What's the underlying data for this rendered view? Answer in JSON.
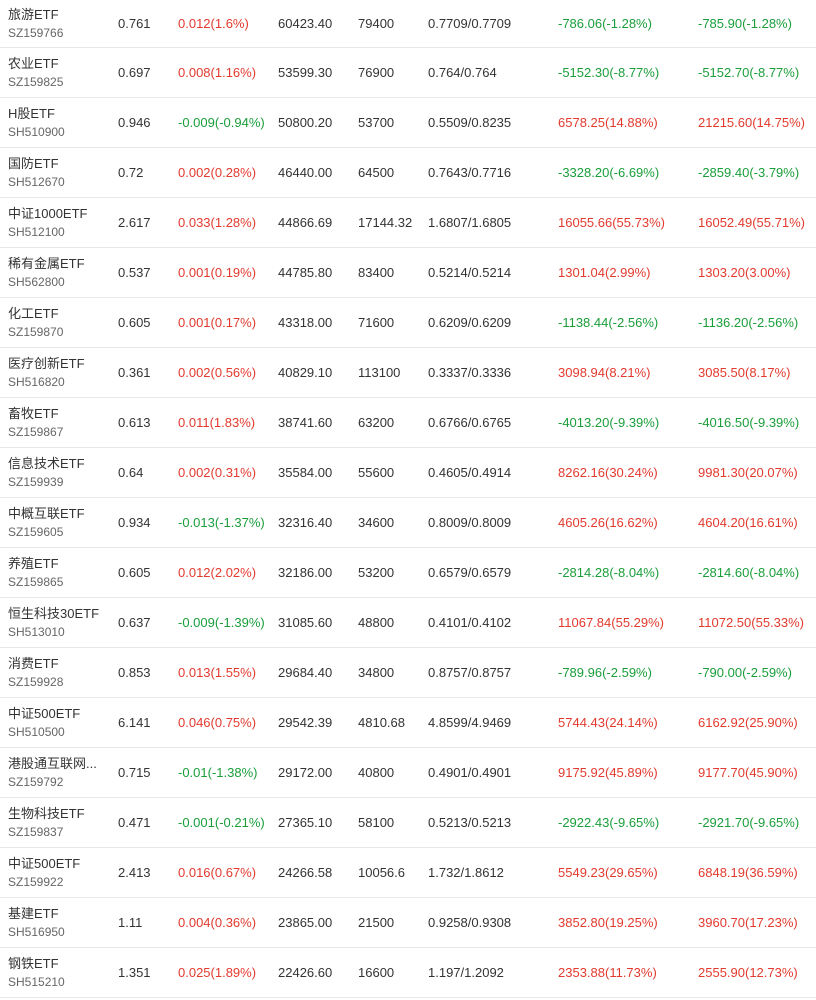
{
  "colors": {
    "up": "#e23a2e",
    "down": "#1a9e3a",
    "text": "#333333",
    "subtext": "#666666",
    "divider": "#e8e8e8"
  },
  "rows": [
    {
      "name": "旅游ETF",
      "code": "SZ159766",
      "price": "0.761",
      "change": "0.012(1.6%)",
      "change_dir": "up",
      "amount": "60423.40",
      "shares": "79400",
      "nav": "0.7709/0.7709",
      "flow1": "-786.06(-1.28%)",
      "flow1_dir": "down",
      "flow2": "-785.90(-1.28%)",
      "flow2_dir": "down"
    },
    {
      "name": "农业ETF",
      "code": "SZ159825",
      "price": "0.697",
      "change": "0.008(1.16%)",
      "change_dir": "up",
      "amount": "53599.30",
      "shares": "76900",
      "nav": "0.764/0.764",
      "flow1": "-5152.30(-8.77%)",
      "flow1_dir": "down",
      "flow2": "-5152.70(-8.77%)",
      "flow2_dir": "down"
    },
    {
      "name": "H股ETF",
      "code": "SH510900",
      "price": "0.946",
      "change": "-0.009(-0.94%)",
      "change_dir": "down",
      "amount": "50800.20",
      "shares": "53700",
      "nav": "0.5509/0.8235",
      "flow1": "6578.25(14.88%)",
      "flow1_dir": "up",
      "flow2": "21215.60(14.75%)",
      "flow2_dir": "up"
    },
    {
      "name": "国防ETF",
      "code": "SH512670",
      "price": "0.72",
      "change": "0.002(0.28%)",
      "change_dir": "up",
      "amount": "46440.00",
      "shares": "64500",
      "nav": "0.7643/0.7716",
      "flow1": "-3328.20(-6.69%)",
      "flow1_dir": "down",
      "flow2": "-2859.40(-3.79%)",
      "flow2_dir": "down"
    },
    {
      "name": "中证1000ETF",
      "code": "SH512100",
      "price": "2.617",
      "change": "0.033(1.28%)",
      "change_dir": "up",
      "amount": "44866.69",
      "shares": "17144.32",
      "nav": "1.6807/1.6805",
      "flow1": "16055.66(55.73%)",
      "flow1_dir": "up",
      "flow2": "16052.49(55.71%)",
      "flow2_dir": "up"
    },
    {
      "name": "稀有金属ETF",
      "code": "SH562800",
      "price": "0.537",
      "change": "0.001(0.19%)",
      "change_dir": "up",
      "amount": "44785.80",
      "shares": "83400",
      "nav": "0.5214/0.5214",
      "flow1": "1301.04(2.99%)",
      "flow1_dir": "up",
      "flow2": "1303.20(3.00%)",
      "flow2_dir": "up"
    },
    {
      "name": "化工ETF",
      "code": "SZ159870",
      "price": "0.605",
      "change": "0.001(0.17%)",
      "change_dir": "up",
      "amount": "43318.00",
      "shares": "71600",
      "nav": "0.6209/0.6209",
      "flow1": "-1138.44(-2.56%)",
      "flow1_dir": "down",
      "flow2": "-1136.20(-2.56%)",
      "flow2_dir": "down"
    },
    {
      "name": "医疗创新ETF",
      "code": "SH516820",
      "price": "0.361",
      "change": "0.002(0.56%)",
      "change_dir": "up",
      "amount": "40829.10",
      "shares": "113100",
      "nav": "0.3337/0.3336",
      "flow1": "3098.94(8.21%)",
      "flow1_dir": "up",
      "flow2": "3085.50(8.17%)",
      "flow2_dir": "up"
    },
    {
      "name": "畜牧ETF",
      "code": "SZ159867",
      "price": "0.613",
      "change": "0.011(1.83%)",
      "change_dir": "up",
      "amount": "38741.60",
      "shares": "63200",
      "nav": "0.6766/0.6765",
      "flow1": "-4013.20(-9.39%)",
      "flow1_dir": "down",
      "flow2": "-4016.50(-9.39%)",
      "flow2_dir": "down"
    },
    {
      "name": "信息技术ETF",
      "code": "SZ159939",
      "price": "0.64",
      "change": "0.002(0.31%)",
      "change_dir": "up",
      "amount": "35584.00",
      "shares": "55600",
      "nav": "0.4605/0.4914",
      "flow1": "8262.16(30.24%)",
      "flow1_dir": "up",
      "flow2": "9981.30(20.07%)",
      "flow2_dir": "up"
    },
    {
      "name": "中概互联ETF",
      "code": "SZ159605",
      "price": "0.934",
      "change": "-0.013(-1.37%)",
      "change_dir": "down",
      "amount": "32316.40",
      "shares": "34600",
      "nav": "0.8009/0.8009",
      "flow1": "4605.26(16.62%)",
      "flow1_dir": "up",
      "flow2": "4604.20(16.61%)",
      "flow2_dir": "up"
    },
    {
      "name": "养殖ETF",
      "code": "SZ159865",
      "price": "0.605",
      "change": "0.012(2.02%)",
      "change_dir": "up",
      "amount": "32186.00",
      "shares": "53200",
      "nav": "0.6579/0.6579",
      "flow1": "-2814.28(-8.04%)",
      "flow1_dir": "down",
      "flow2": "-2814.60(-8.04%)",
      "flow2_dir": "down"
    },
    {
      "name": "恒生科技30ETF",
      "code": "SH513010",
      "price": "0.637",
      "change": "-0.009(-1.39%)",
      "change_dir": "down",
      "amount": "31085.60",
      "shares": "48800",
      "nav": "0.4101/0.4102",
      "flow1": "11067.84(55.29%)",
      "flow1_dir": "up",
      "flow2": "11072.50(55.33%)",
      "flow2_dir": "up"
    },
    {
      "name": "消费ETF",
      "code": "SZ159928",
      "price": "0.853",
      "change": "0.013(1.55%)",
      "change_dir": "up",
      "amount": "29684.40",
      "shares": "34800",
      "nav": "0.8757/0.8757",
      "flow1": "-789.96(-2.59%)",
      "flow1_dir": "down",
      "flow2": "-790.00(-2.59%)",
      "flow2_dir": "down"
    },
    {
      "name": "中证500ETF",
      "code": "SH510500",
      "price": "6.141",
      "change": "0.046(0.75%)",
      "change_dir": "up",
      "amount": "29542.39",
      "shares": "4810.68",
      "nav": "4.8599/4.9469",
      "flow1": "5744.43(24.14%)",
      "flow1_dir": "up",
      "flow2": "6162.92(25.90%)",
      "flow2_dir": "up"
    },
    {
      "name": "港股通互联网...",
      "code": "SZ159792",
      "price": "0.715",
      "change": "-0.01(-1.38%)",
      "change_dir": "down",
      "amount": "29172.00",
      "shares": "40800",
      "nav": "0.4901/0.4901",
      "flow1": "9175.92(45.89%)",
      "flow1_dir": "up",
      "flow2": "9177.70(45.90%)",
      "flow2_dir": "up"
    },
    {
      "name": "生物科技ETF",
      "code": "SZ159837",
      "price": "0.471",
      "change": "-0.001(-0.21%)",
      "change_dir": "down",
      "amount": "27365.10",
      "shares": "58100",
      "nav": "0.5213/0.5213",
      "flow1": "-2922.43(-9.65%)",
      "flow1_dir": "down",
      "flow2": "-2921.70(-9.65%)",
      "flow2_dir": "down"
    },
    {
      "name": "中证500ETF",
      "code": "SZ159922",
      "price": "2.413",
      "change": "0.016(0.67%)",
      "change_dir": "up",
      "amount": "24266.58",
      "shares": "10056.6",
      "nav": "1.732/1.8612",
      "flow1": "5549.23(29.65%)",
      "flow1_dir": "up",
      "flow2": "6848.19(36.59%)",
      "flow2_dir": "up"
    },
    {
      "name": "基建ETF",
      "code": "SH516950",
      "price": "1.11",
      "change": "0.004(0.36%)",
      "change_dir": "up",
      "amount": "23865.00",
      "shares": "21500",
      "nav": "0.9258/0.9308",
      "flow1": "3852.80(19.25%)",
      "flow1_dir": "up",
      "flow2": "3960.70(17.23%)",
      "flow2_dir": "up"
    },
    {
      "name": "钢铁ETF",
      "code": "SH515210",
      "price": "1.351",
      "change": "0.025(1.89%)",
      "change_dir": "up",
      "amount": "22426.60",
      "shares": "16600",
      "nav": "1.197/1.2092",
      "flow1": "2353.88(11.73%)",
      "flow1_dir": "up",
      "flow2": "2555.90(12.73%)",
      "flow2_dir": "up"
    }
  ]
}
